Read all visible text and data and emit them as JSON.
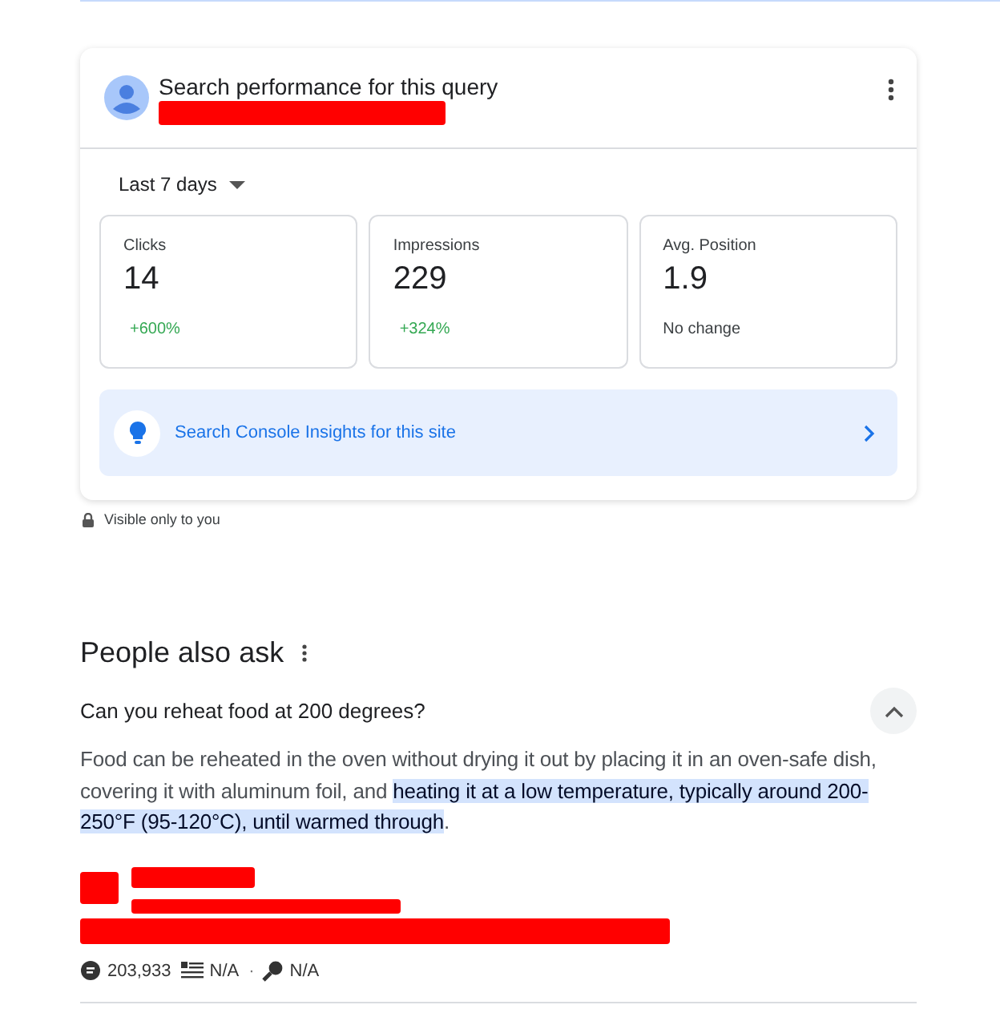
{
  "performance_card": {
    "title": "Search performance for this query",
    "period": "Last 7 days",
    "metrics": [
      {
        "label": "Clicks",
        "value": "14",
        "change": "+600%",
        "positive": true
      },
      {
        "label": "Impressions",
        "value": "229",
        "change": "+324%",
        "positive": true
      },
      {
        "label": "Avg. Position",
        "value": "1.9",
        "change": "No change",
        "positive": false
      }
    ],
    "insights_link": "Search Console Insights for this site"
  },
  "visibility_note": "Visible only to you",
  "people_also_ask": {
    "heading": "People also ask",
    "questions": [
      {
        "question": "Can you reheat food at 200 degrees?",
        "expanded": true,
        "answer": "Food can be reheated in the oven without drying it out by placing it in an oven-safe dish, covering it with aluminum foil, and ",
        "answer_highlight": "heating it at a low temperature, typically around 200-250°F (95-120°C), until warmed through",
        "answer_end": ".",
        "stats": [
          {
            "kind": "traffic",
            "text": "203,933"
          },
          {
            "kind": "list",
            "text": "N/A"
          },
          {
            "kind": "key",
            "separator": "·",
            "text": "N/A"
          }
        ]
      }
    ]
  }
}
